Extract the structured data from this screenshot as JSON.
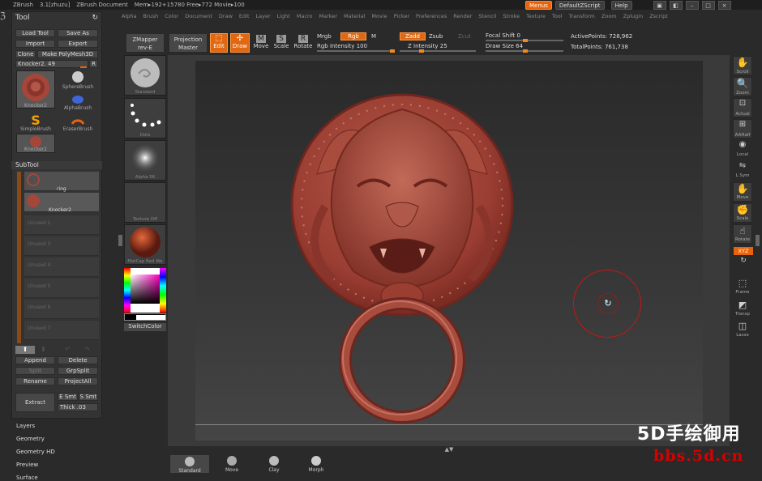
{
  "titlebar": {
    "app": "ZBrush",
    "version": "3.1[zhuzu]",
    "document": "ZBrush Document",
    "mem": "Mem▸192+15780 Free▸772 Movie▸100"
  },
  "menubar": [
    "Alpha",
    "Brush",
    "Color",
    "Document",
    "Draw",
    "Edit",
    "Layer",
    "Light",
    "Macro",
    "Marker",
    "Material",
    "Movie",
    "Picker",
    "Preferences",
    "Render",
    "Stencil",
    "Stroke",
    "Texture",
    "Tool",
    "Transform",
    "Zoom",
    "Zplugin",
    "Zscript"
  ],
  "topright": {
    "menus": "Menus",
    "script": "DefaultZScript",
    "help": "Help"
  },
  "tool": {
    "title": "Tool",
    "load": "Load Tool",
    "save_as": "Save As",
    "import": "Import",
    "export": "Export",
    "clone": "Clone",
    "make_polymesh": "Make PolyMesh3D",
    "current": "Knocker2. 49",
    "r": "R",
    "thumbs": {
      "knocker": "Knocker2",
      "sphere": "SphereBrush",
      "alpha": "AlphaBrush",
      "simple": "SimpleBrush",
      "eraser": "EraserBrush",
      "knocker2": "Knocker2"
    },
    "subtool_title": "SubTool",
    "subtools": [
      "ring",
      "Knocker2",
      "Unused 2",
      "Unused 3",
      "Unused 4",
      "Unused 5",
      "Unused 6",
      "Unused 7"
    ],
    "append": "Append",
    "delete": "Delete",
    "split": "Split",
    "grpsplit": "GrpSplit",
    "rename": "Rename",
    "projectall": "ProjectAll",
    "extract": "Extract",
    "e_smt": "E Smt",
    "s_smt": "S Smt",
    "thick": "Thick",
    "thick_val": ".03"
  },
  "leftmenus": [
    "Layers",
    "Geometry",
    "Geometry HD",
    "Preview",
    "Surface"
  ],
  "brushes": [
    {
      "label": "Standard"
    },
    {
      "label": "Dots"
    },
    {
      "label": "Alpha 56"
    },
    {
      "label": "Texture Off"
    },
    {
      "label": "MatCap Red Wa"
    }
  ],
  "switchcolor": "SwitchColor",
  "toolbar": {
    "zmapper": "ZMapper",
    "zmapper2": "rev-E",
    "projection": "Projection",
    "projection2": "Master",
    "edit": "Edit",
    "draw": "Draw",
    "move": "Move",
    "scale": "Scale",
    "rotate": "Rotate",
    "mrgb": "Mrgb",
    "rgb": "Rgb",
    "m": "M",
    "rgb_intensity_label": "Rgb Intensity",
    "rgb_intensity": "100",
    "zadd": "Zadd",
    "zsub": "Zsub",
    "zcut": "Zcut",
    "z_intensity_label": "Z Intensity",
    "z_intensity": "25",
    "focal_label": "Focal Shift",
    "focal": "0",
    "drawsize_label": "Draw Size",
    "drawsize": "64",
    "active_label": "ActivePoints:",
    "active": "728,962",
    "total_label": "TotalPoints:",
    "total": "761,738"
  },
  "rightshelf": [
    "Scroll",
    "Zoom",
    "Actual",
    "AAHalf",
    "Local",
    "L.Sym",
    "Move",
    "Scale",
    "Rotate",
    "XYZ",
    "",
    "Frame",
    "Transp",
    "Lasso"
  ],
  "bottomshelf": [
    "Standard",
    "Move",
    "Clay",
    "Morph"
  ],
  "watermark": {
    "line1": "5D手绘御用",
    "line2": "bbs.5d.cn"
  },
  "colors": {
    "accent": "#e8630a",
    "model": "#a8443a"
  }
}
